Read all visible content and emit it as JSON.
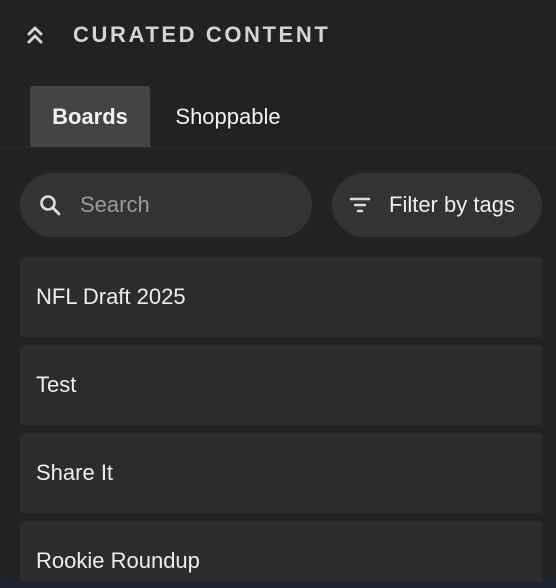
{
  "header": {
    "title": "CURATED CONTENT",
    "collapse_icon": "chevron-double-up-icon"
  },
  "tabs": [
    {
      "label": "Boards",
      "active": true
    },
    {
      "label": "Shoppable",
      "active": false
    }
  ],
  "search": {
    "placeholder": "Search",
    "value": "",
    "icon": "search-icon"
  },
  "filter": {
    "label": "Filter by tags",
    "icon": "filter-icon"
  },
  "boards": [
    {
      "label": "NFL Draft 2025"
    },
    {
      "label": "Test"
    },
    {
      "label": "Share It"
    },
    {
      "label": "Rookie Roundup"
    }
  ],
  "colors": {
    "panel_bg": "#222222",
    "active_tab_bg": "#444444",
    "control_bg": "#333333",
    "item_bg": "#2c2c2c",
    "text": "#eeeeee",
    "page_bg": "#1c2433"
  }
}
